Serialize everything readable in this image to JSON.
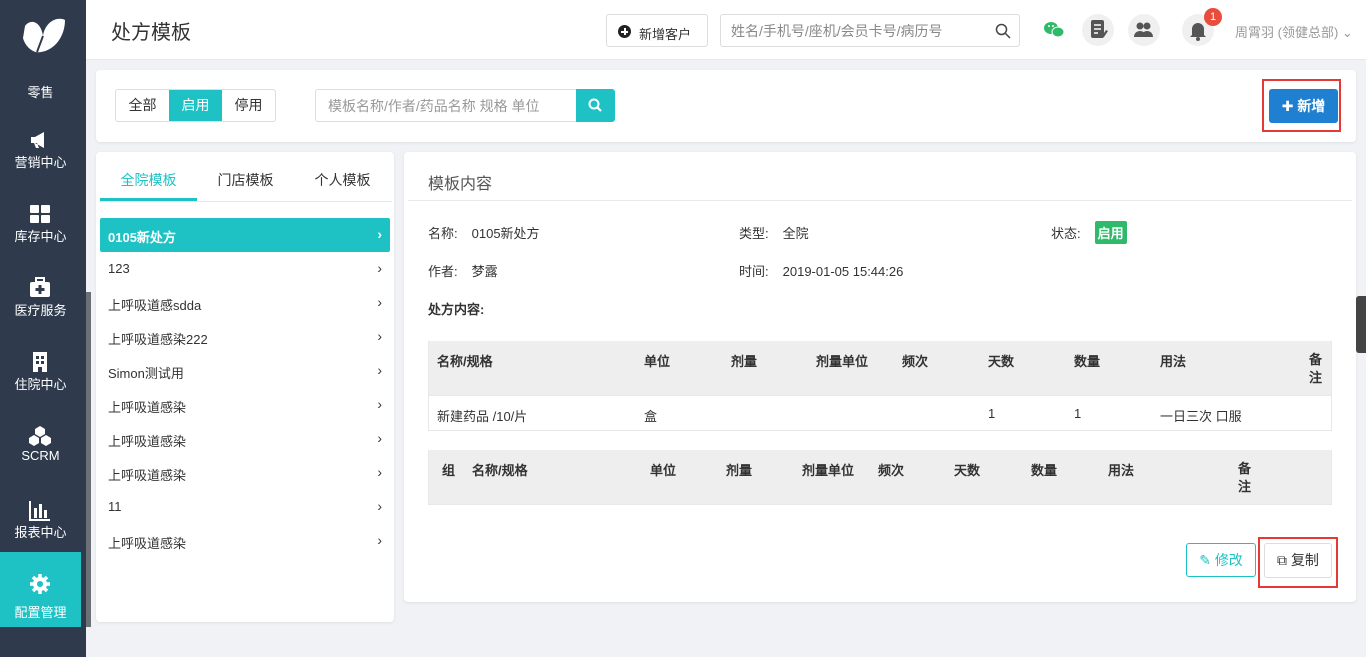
{
  "page_title": "处方模板",
  "sidebar": {
    "items": [
      {
        "label": "零售",
        "icon": "butterfly-logo-icon"
      },
      {
        "label": "营销中心",
        "icon": "megaphone-icon"
      },
      {
        "label": "库存中心",
        "icon": "grid-icon"
      },
      {
        "label": "医疗服务",
        "icon": "medical-kit-icon"
      },
      {
        "label": "住院中心",
        "icon": "hospital-icon"
      },
      {
        "label": "SCRM",
        "icon": "cubes-icon"
      },
      {
        "label": "报表中心",
        "icon": "bar-chart-icon"
      },
      {
        "label": "配置管理",
        "icon": "gear-icon"
      }
    ]
  },
  "header": {
    "new_customer_label": "新增客户",
    "search_placeholder": "姓名/手机号/座机/会员卡号/病历号",
    "notification_count": "1",
    "user_label": "周霄羽 (领健总部) ⌄"
  },
  "filter": {
    "options": [
      "全部",
      "启用",
      "停用"
    ],
    "selected": "启用",
    "search_placeholder": "模板名称/作者/药品名称 规格 单位",
    "add_label": "新增"
  },
  "template_tabs": [
    "全院模板",
    "门店模板",
    "个人模板"
  ],
  "templates": [
    "0105新处方",
    "123",
    "上呼吸道感sdda",
    "上呼吸道感染222",
    "Simon测试用",
    "上呼吸道感染",
    "上呼吸道感染",
    "上呼吸道感染",
    "11",
    "上呼吸道感染"
  ],
  "detail": {
    "title": "模板内容",
    "name_key": "名称:",
    "name": "0105新处方",
    "type_key": "类型:",
    "type": "全院",
    "status_key": "状态:",
    "status": "启用",
    "author_key": "作者:",
    "author": "梦露",
    "time_key": "时间:",
    "time": "2019-01-05 15:44:26",
    "rx_label": "处方内容:",
    "table1": {
      "headers": [
        "名称/规格",
        "单位",
        "剂量",
        "剂量单位",
        "频次",
        "天数",
        "数量",
        "用法",
        "备注"
      ],
      "rows": [
        [
          "新建药品 /10/片",
          "盒",
          "",
          "",
          "",
          "1",
          "1",
          "一日三次 口服",
          ""
        ]
      ]
    },
    "table2": {
      "headers": [
        "组",
        "名称/规格",
        "单位",
        "剂量",
        "剂量单位",
        "频次",
        "天数",
        "数量",
        "用法",
        "备注"
      ]
    },
    "edit_label": "修改",
    "copy_label": "复制"
  },
  "colors": {
    "accent": "#1ec2c4",
    "sidebar": "#2f3b4c",
    "primary": "#1f7fd0",
    "highlight": "#e53935",
    "status": "#2fba69"
  }
}
